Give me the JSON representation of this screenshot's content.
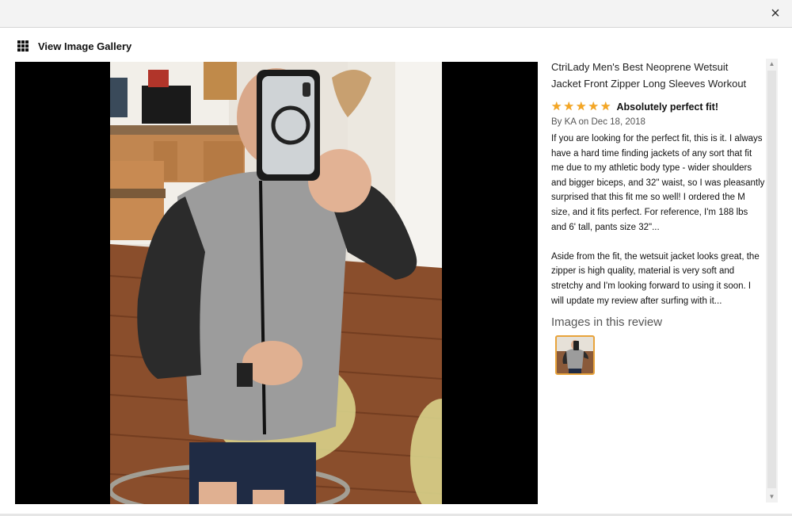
{
  "modal": {
    "close_label": "×",
    "gallery_label": "View Image Gallery"
  },
  "review": {
    "product_title": "CtriLady Men's Best Neoprene Wetsuit\nJacket Front Zipper Long Sleeves Workout",
    "rating": 5,
    "stars": [
      "★",
      "★",
      "★",
      "★",
      "★"
    ],
    "title": "Absolutely perfect fit!",
    "byline": "By KA on Dec 18, 2018",
    "body_p1": "If you are looking for the perfect fit, this is it. I always have a hard time finding jackets of any sort that fit me due to my athletic body type - wider shoulders and bigger biceps, and 32\" waist, so I was pleasantly surprised that this fit me so well! I ordered the M size, and it fits perfect. For reference, I'm 188 lbs and 6' tall, pants size 32\"...",
    "body_p2": "Aside from the fit, the wetsuit jacket looks great, the zipper is high quality, material is very soft and stretchy and I'm looking forward to using it soon. I will update my review after surfing with it...",
    "images_heading": "Images in this review"
  },
  "scrollbar": {
    "up": "▲",
    "down": "▼"
  },
  "colors": {
    "star": "#f5a623",
    "thumb_border": "#e8a33b",
    "viewer_bg": "#000000"
  }
}
